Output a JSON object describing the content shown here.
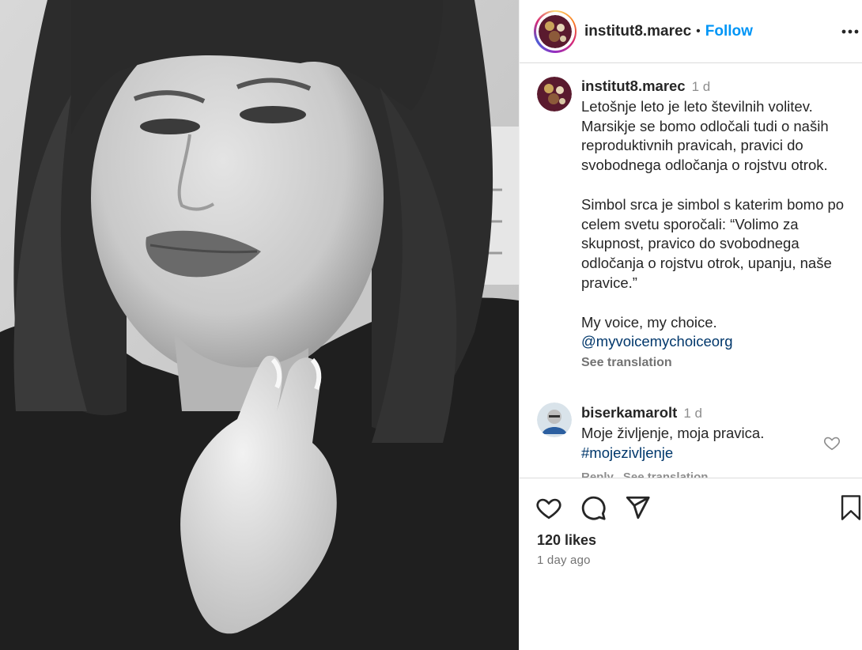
{
  "post": {
    "username": "institut8.marec",
    "follow_label": "Follow",
    "separator": "•",
    "more_icon": "more-horizontal-icon"
  },
  "caption": {
    "username": "institut8.marec",
    "time": "1 d",
    "paragraph1": "Letošnje leto je leto številnih volitev. Marsikje se bomo odločali tudi o naših reproduktivnih pravicah, pravici do svobodnega odločanja o rojstvu otrok.",
    "paragraph2": "Simbol srca je simbol s katerim bomo po celem svetu sporočali: “Volimo za skupnost, pravico do svobodnega odločanja o rojstvu otrok, upanju, naše pravice.”",
    "paragraph3": "My voice, my choice.",
    "mention": "@myvoicemychoiceorg",
    "see_translation": "See translation"
  },
  "comment": {
    "username": "biserkamarolt",
    "time": "1 d",
    "text": "Moje življenje, moja pravica.",
    "hashtag": "#mojezivljenje",
    "reply_label": "Reply",
    "see_translation": "See translation"
  },
  "actions": {
    "likes": "120 likes",
    "time_ago": "1 day ago",
    "icons": [
      "heart-icon",
      "comment-icon",
      "share-icon",
      "bookmark-icon"
    ]
  },
  "colors": {
    "follow": "#0095f6",
    "link": "#00376b",
    "muted": "#8e8e8e",
    "text": "#262626"
  }
}
